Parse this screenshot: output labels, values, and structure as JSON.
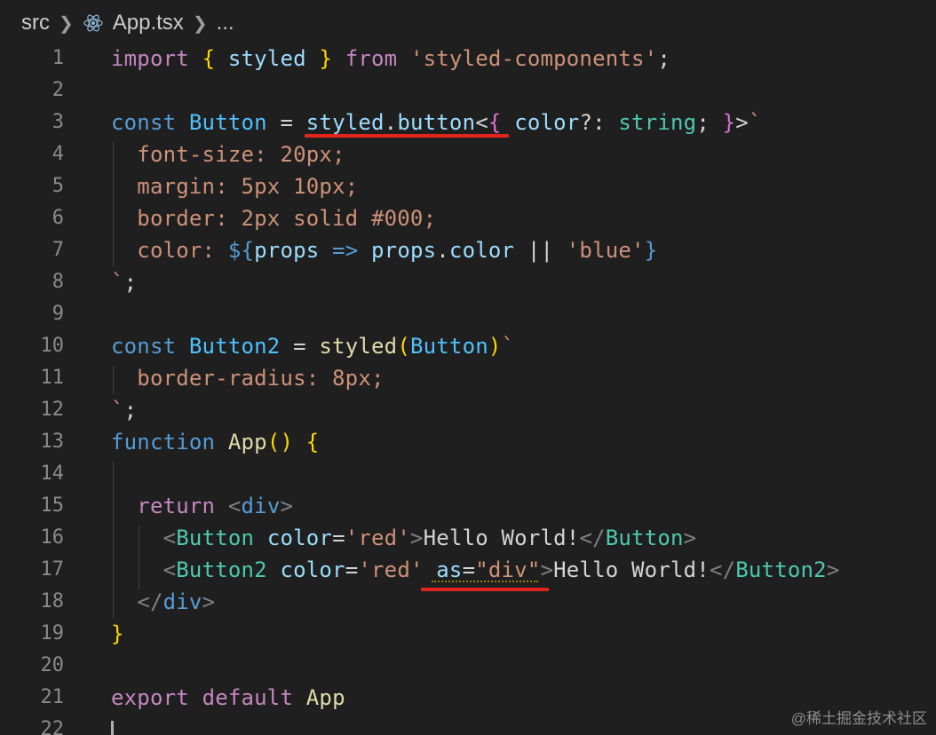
{
  "breadcrumb": {
    "folder": "src",
    "file": "App.tsx",
    "more": "...",
    "file_icon": "react-icon"
  },
  "colors": {
    "background": "#1f1f1f",
    "keyword_import": "#c586c0",
    "keyword_decl": "#569cd6",
    "type_name": "#4ec9b0",
    "function_name": "#dcdcaa",
    "variable": "#9cdcfe",
    "string": "#ce9178",
    "bracket_gold": "#ffd700",
    "bracket_pink": "#da70d6",
    "bracket_blue": "#179fff",
    "tag_punct": "#808080",
    "annotation_underline": "#e3241c"
  },
  "lines": [
    {
      "n": "1",
      "tokens": [
        {
          "t": "import",
          "c": "#c586c0"
        },
        {
          "t": " ",
          "c": "#d4d4d4"
        },
        {
          "t": "{",
          "c": "#ffd700"
        },
        {
          "t": " styled ",
          "c": "#9cdcfe"
        },
        {
          "t": "}",
          "c": "#ffd700"
        },
        {
          "t": " from ",
          "c": "#c586c0"
        },
        {
          "t": "'styled-components'",
          "c": "#ce9178"
        },
        {
          "t": ";",
          "c": "#d4d4d4"
        }
      ]
    },
    {
      "n": "2",
      "tokens": []
    },
    {
      "n": "3",
      "tokens": [
        {
          "t": "const",
          "c": "#569cd6"
        },
        {
          "t": " ",
          "c": "#d4d4d4"
        },
        {
          "t": "Button",
          "c": "#4fc1ff"
        },
        {
          "t": " = ",
          "c": "#d4d4d4"
        },
        {
          "t": "styled",
          "c": "#9cdcfe"
        },
        {
          "t": ".",
          "c": "#d4d4d4"
        },
        {
          "t": "button",
          "c": "#9cdcfe"
        },
        {
          "t": "<",
          "c": "#d4d4d4"
        },
        {
          "t": "{",
          "c": "#da70d6"
        },
        {
          "t": " color",
          "c": "#9cdcfe"
        },
        {
          "t": "?: ",
          "c": "#d4d4d4"
        },
        {
          "t": "string",
          "c": "#4ec9b0"
        },
        {
          "t": "; ",
          "c": "#d4d4d4"
        },
        {
          "t": "}",
          "c": "#da70d6"
        },
        {
          "t": ">",
          "c": "#d4d4d4"
        },
        {
          "t": "`",
          "c": "#ce9178"
        }
      ]
    },
    {
      "n": "4",
      "tokens": [
        {
          "t": "  font-size: 20px;",
          "c": "#ce9178"
        }
      ]
    },
    {
      "n": "5",
      "tokens": [
        {
          "t": "  margin: 5px 10px;",
          "c": "#ce9178"
        }
      ]
    },
    {
      "n": "6",
      "tokens": [
        {
          "t": "  border: 2px solid #000;",
          "c": "#ce9178"
        }
      ]
    },
    {
      "n": "7",
      "tokens": [
        {
          "t": "  color: ",
          "c": "#ce9178"
        },
        {
          "t": "${",
          "c": "#569cd6"
        },
        {
          "t": "props",
          "c": "#9cdcfe"
        },
        {
          "t": " => ",
          "c": "#569cd6"
        },
        {
          "t": "props",
          "c": "#9cdcfe"
        },
        {
          "t": ".",
          "c": "#d4d4d4"
        },
        {
          "t": "color",
          "c": "#9cdcfe"
        },
        {
          "t": " || ",
          "c": "#d4d4d4"
        },
        {
          "t": "'blue'",
          "c": "#ce9178"
        },
        {
          "t": "}",
          "c": "#569cd6"
        }
      ]
    },
    {
      "n": "8",
      "tokens": [
        {
          "t": "`",
          "c": "#ce9178"
        },
        {
          "t": ";",
          "c": "#d4d4d4"
        }
      ]
    },
    {
      "n": "9",
      "tokens": []
    },
    {
      "n": "10",
      "tokens": [
        {
          "t": "const",
          "c": "#569cd6"
        },
        {
          "t": " ",
          "c": "#d4d4d4"
        },
        {
          "t": "Button2",
          "c": "#4fc1ff"
        },
        {
          "t": " = ",
          "c": "#d4d4d4"
        },
        {
          "t": "styled",
          "c": "#dcdcaa"
        },
        {
          "t": "(",
          "c": "#ffd700"
        },
        {
          "t": "Button",
          "c": "#4fc1ff"
        },
        {
          "t": ")",
          "c": "#ffd700"
        },
        {
          "t": "`",
          "c": "#ce9178"
        }
      ]
    },
    {
      "n": "11",
      "tokens": [
        {
          "t": "  border-radius: 8px;",
          "c": "#ce9178"
        }
      ]
    },
    {
      "n": "12",
      "tokens": [
        {
          "t": "`",
          "c": "#ce9178"
        },
        {
          "t": ";",
          "c": "#d4d4d4"
        }
      ]
    },
    {
      "n": "13",
      "tokens": [
        {
          "t": "function",
          "c": "#569cd6"
        },
        {
          "t": " ",
          "c": "#d4d4d4"
        },
        {
          "t": "App",
          "c": "#dcdcaa"
        },
        {
          "t": "()",
          "c": "#ffd700"
        },
        {
          "t": " ",
          "c": "#d4d4d4"
        },
        {
          "t": "{",
          "c": "#ffd700"
        }
      ]
    },
    {
      "n": "14",
      "tokens": []
    },
    {
      "n": "15",
      "tokens": [
        {
          "t": "  return",
          "c": "#c586c0"
        },
        {
          "t": " ",
          "c": "#d4d4d4"
        },
        {
          "t": "<",
          "c": "#808080"
        },
        {
          "t": "div",
          "c": "#569cd6"
        },
        {
          "t": ">",
          "c": "#808080"
        }
      ]
    },
    {
      "n": "16",
      "tokens": [
        {
          "t": "    ",
          "c": "#d4d4d4"
        },
        {
          "t": "<",
          "c": "#808080"
        },
        {
          "t": "Button",
          "c": "#4ec9b0"
        },
        {
          "t": " color",
          "c": "#9cdcfe"
        },
        {
          "t": "=",
          "c": "#d4d4d4"
        },
        {
          "t": "'red'",
          "c": "#ce9178"
        },
        {
          "t": ">",
          "c": "#808080"
        },
        {
          "t": "Hello World!",
          "c": "#d4d4d4"
        },
        {
          "t": "</",
          "c": "#808080"
        },
        {
          "t": "Button",
          "c": "#4ec9b0"
        },
        {
          "t": ">",
          "c": "#808080"
        }
      ]
    },
    {
      "n": "17",
      "tokens": [
        {
          "t": "    ",
          "c": "#d4d4d4"
        },
        {
          "t": "<",
          "c": "#808080"
        },
        {
          "t": "Button2",
          "c": "#4ec9b0"
        },
        {
          "t": " color",
          "c": "#9cdcfe"
        },
        {
          "t": "=",
          "c": "#d4d4d4"
        },
        {
          "t": "'red'",
          "c": "#ce9178"
        },
        {
          "t": " as",
          "c": "#9cdcfe"
        },
        {
          "t": "=",
          "c": "#d4d4d4"
        },
        {
          "t": "\"div\"",
          "c": "#ce9178"
        },
        {
          "t": ">",
          "c": "#808080"
        },
        {
          "t": "Hello World!",
          "c": "#d4d4d4"
        },
        {
          "t": "</",
          "c": "#808080"
        },
        {
          "t": "Button2",
          "c": "#4ec9b0"
        },
        {
          "t": ">",
          "c": "#808080"
        }
      ]
    },
    {
      "n": "18",
      "tokens": [
        {
          "t": "  ",
          "c": "#d4d4d4"
        },
        {
          "t": "</",
          "c": "#808080"
        },
        {
          "t": "div",
          "c": "#569cd6"
        },
        {
          "t": ">",
          "c": "#808080"
        }
      ]
    },
    {
      "n": "19",
      "tokens": [
        {
          "t": "}",
          "c": "#ffd700"
        }
      ]
    },
    {
      "n": "20",
      "tokens": []
    },
    {
      "n": "21",
      "tokens": [
        {
          "t": "export",
          "c": "#c586c0"
        },
        {
          "t": " ",
          "c": "#d4d4d4"
        },
        {
          "t": "default",
          "c": "#c586c0"
        },
        {
          "t": " ",
          "c": "#d4d4d4"
        },
        {
          "t": "App",
          "c": "#dcdcaa"
        }
      ]
    },
    {
      "n": "22",
      "tokens": []
    }
  ],
  "watermark": "@稀土掘金技术社区"
}
